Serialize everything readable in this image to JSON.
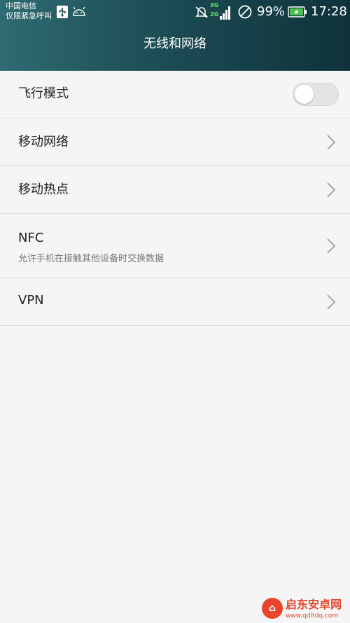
{
  "status_bar": {
    "carrier_line1": "中国电信",
    "carrier_line2": "仅限紧急呼叫",
    "network_top": "3G",
    "network_bottom": "2G",
    "battery_percent": "99%",
    "time": "17:28",
    "icons": [
      "usb-icon",
      "android-icon",
      "mute-icon",
      "signal-icon",
      "no-disturb-icon",
      "battery-charging-icon"
    ]
  },
  "header": {
    "title": "无线和网络"
  },
  "settings": {
    "airplane": {
      "label": "飞行模式",
      "toggle_on": false
    },
    "mobile_network": {
      "label": "移动网络"
    },
    "hotspot": {
      "label": "移动热点"
    },
    "nfc": {
      "label": "NFC",
      "description": "允许手机在接触其他设备时交换数据"
    },
    "vpn": {
      "label": "VPN"
    }
  },
  "watermark": {
    "name": "启东安卓网",
    "url": "www.qdltdq.com"
  },
  "colors": {
    "header_start": "#2f6b71",
    "header_end": "#0f323b",
    "background": "#f5f5f5",
    "divider": "#dcdcdc",
    "charge_green": "#4cc04a",
    "watermark_red": "#e8452c"
  }
}
